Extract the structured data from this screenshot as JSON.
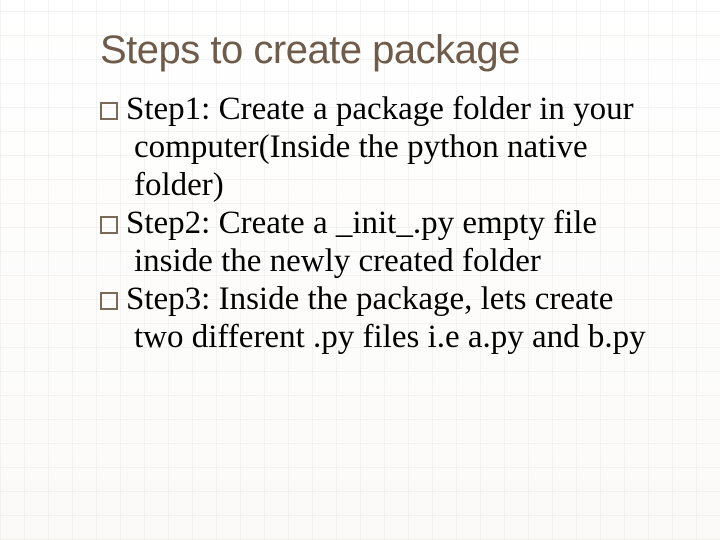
{
  "title": "Steps to create package",
  "items": [
    "Step1: Create a package folder in your computer(Inside the python native folder)",
    "Step2: Create a _init_.py empty file inside the newly created folder",
    "Step3: Inside the package, lets create two different .py files i.e a.py and b.py"
  ]
}
